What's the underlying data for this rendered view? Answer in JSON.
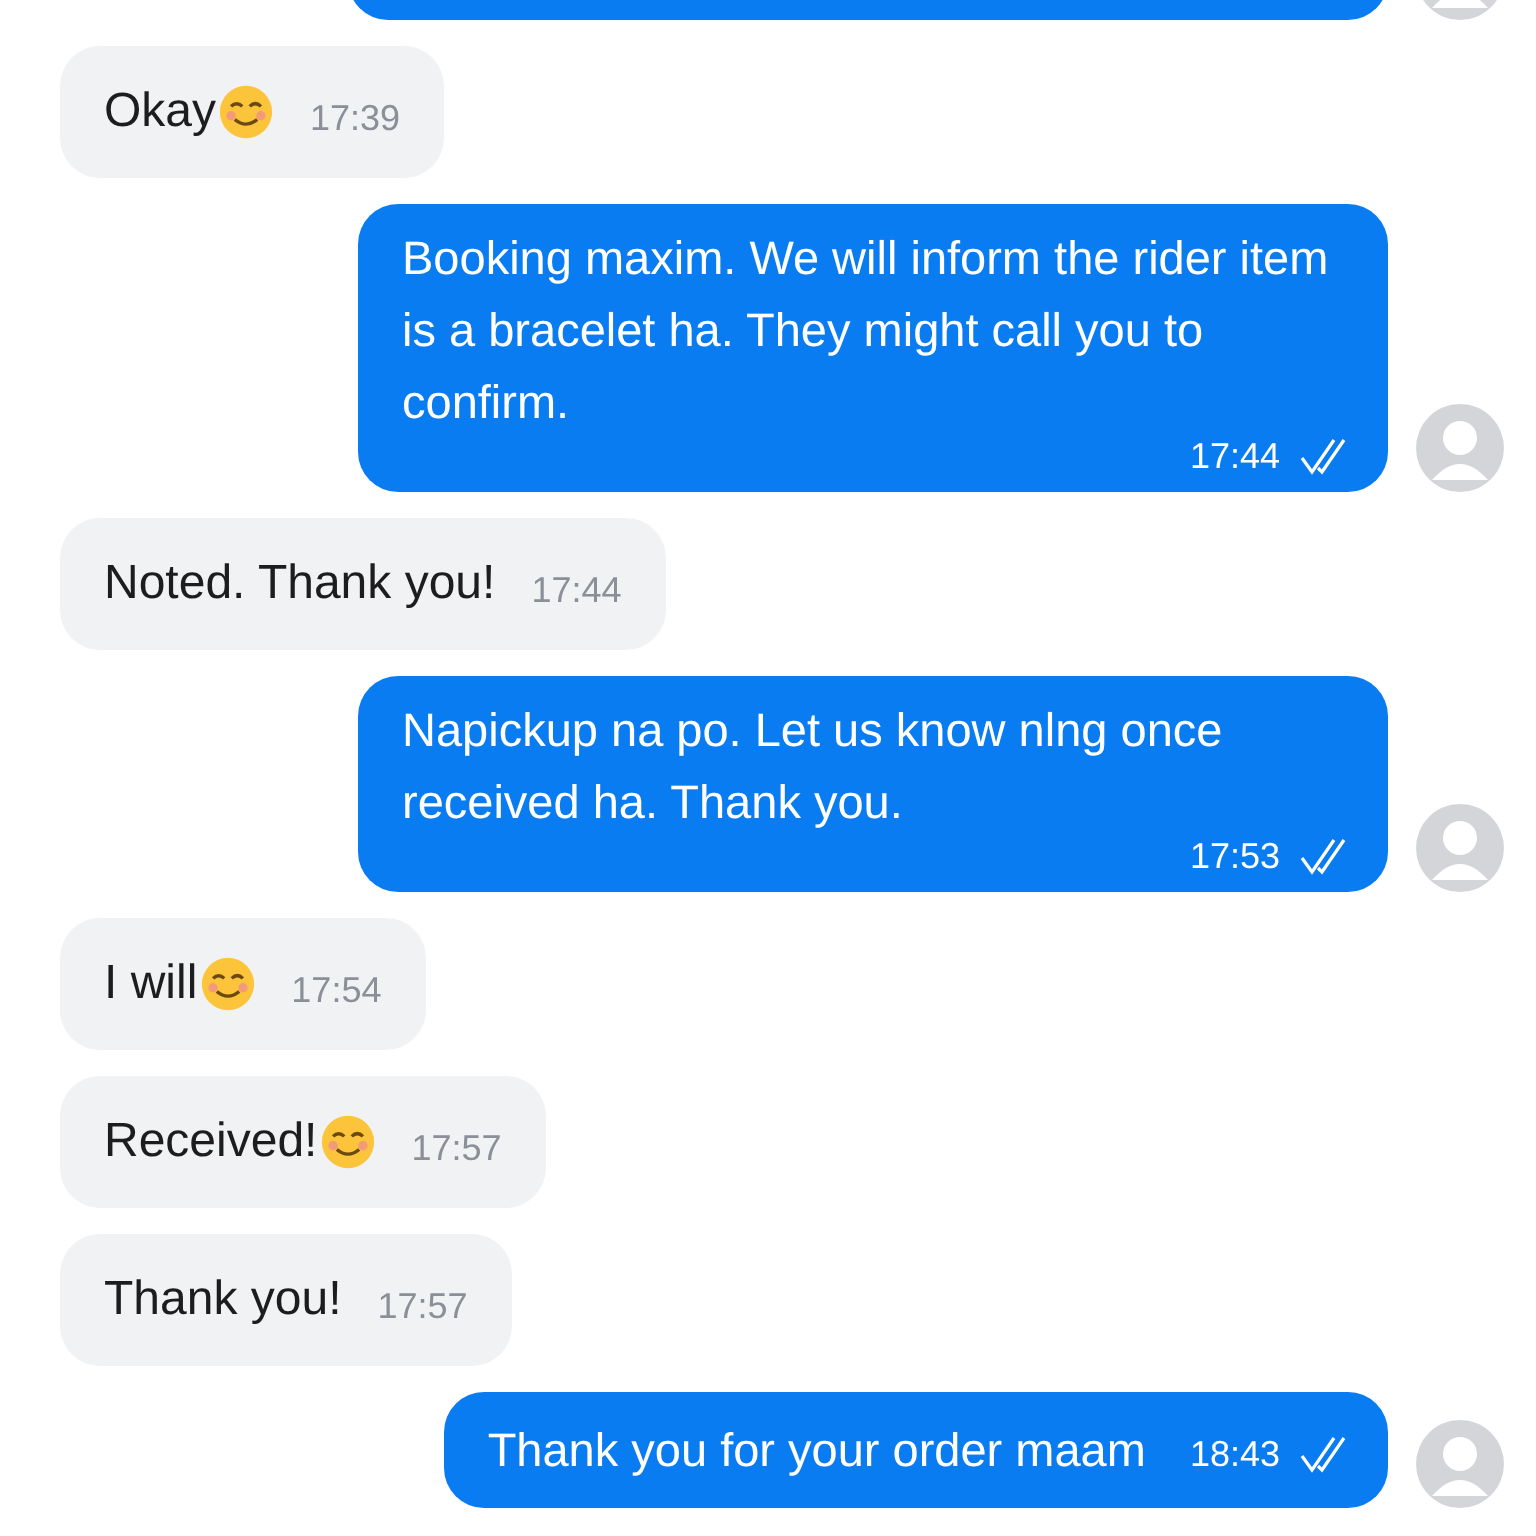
{
  "messages": [
    {
      "outgoing": true
    },
    {
      "outgoing": false,
      "text": "Okay",
      "emoji": true,
      "time": "17:39"
    },
    {
      "outgoing": true,
      "text": "Booking maxim. We will inform the rider item is a bracelet ha. They might call you to confirm.",
      "time": "17:44",
      "read": true
    },
    {
      "outgoing": false,
      "text": "Noted. Thank you!",
      "emoji": false,
      "time": "17:44"
    },
    {
      "outgoing": true,
      "text": "Napickup na po. Let us know nlng once received ha. Thank you.",
      "time": "17:53",
      "read": true
    },
    {
      "outgoing": false,
      "text": "I will",
      "emoji": true,
      "time": "17:54"
    },
    {
      "outgoing": false,
      "text": "Received!",
      "emoji": true,
      "time": "17:57"
    },
    {
      "outgoing": false,
      "text": "Thank you!",
      "emoji": false,
      "time": "17:57"
    },
    {
      "outgoing": true,
      "text": "Thank you for your order maam",
      "time": "18:43",
      "read": true
    }
  ]
}
